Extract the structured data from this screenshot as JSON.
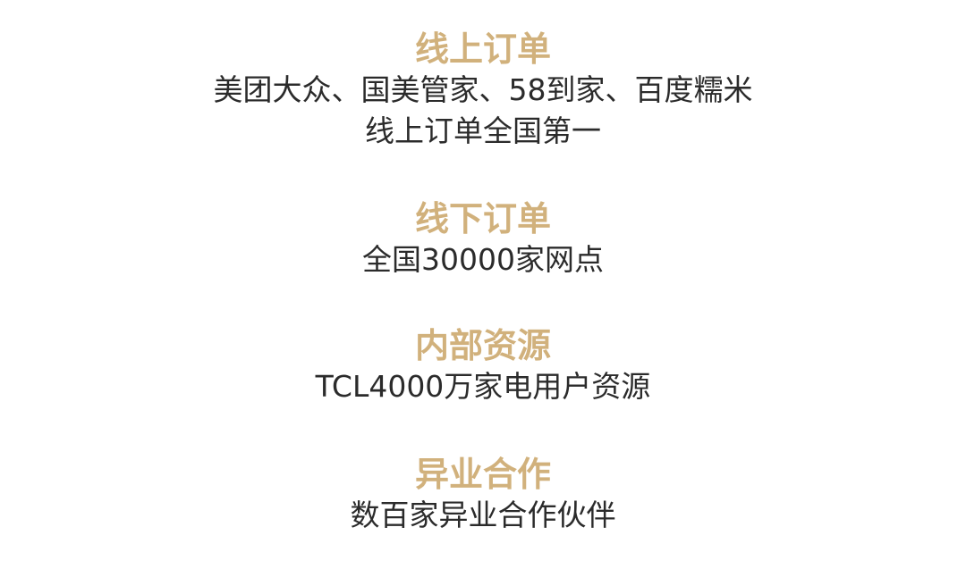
{
  "sections": [
    {
      "heading": "线上订单",
      "lines": [
        "美团大众、国美管家、58到家、百度糯米",
        "线上订单全国第一"
      ]
    },
    {
      "heading": "线下订单",
      "lines": [
        "全国30000家网点"
      ]
    },
    {
      "heading": "内部资源",
      "lines": [
        "TCL4000万家电用户资源"
      ]
    },
    {
      "heading": "异业合作",
      "lines": [
        "数百家异业合作伙伴"
      ]
    }
  ],
  "colors": {
    "heading": "#d1b17c",
    "body_text": "#2b2b2b",
    "background": "#ffffff"
  }
}
